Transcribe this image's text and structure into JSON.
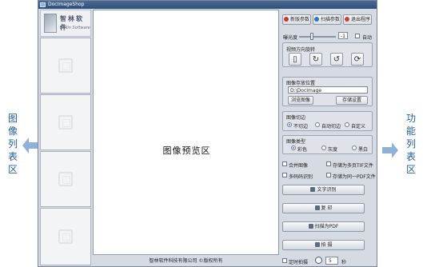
{
  "window": {
    "title": "DocImageShop"
  },
  "logo": {
    "brand_cn": "智林软件",
    "brand_en": "Zhilin Software"
  },
  "preview": {
    "label": "图像预览区"
  },
  "footer": {
    "copyright": "智林软件科技有限公司 ©版权所有"
  },
  "toolbar": {
    "new_params": "新版参数",
    "scan_params": "扫描参数",
    "exit": "退出程序"
  },
  "exposure": {
    "label": "曝光度",
    "value": "-1",
    "auto_label": "自动",
    "level": 0.35
  },
  "rotation": {
    "title": "视频方向旋转"
  },
  "storage": {
    "title": "图像存放位置",
    "path": "D:\\DocImage",
    "browse": "浏览图像",
    "save_settings": "存储设置"
  },
  "crop": {
    "title": "图像切边",
    "options": [
      "不切边",
      "自动切边",
      "自定义"
    ],
    "selected": 0
  },
  "color": {
    "title": "图像类型",
    "options": [
      "彩色",
      "灰度",
      "黑白"
    ],
    "selected": 0
  },
  "options": {
    "merge_image": "合并图像",
    "save_multi_tif": "存储为多页TIF文件",
    "multi_barcode": "多码码识别",
    "save_single_pdf": "存储为同一PDF文件"
  },
  "actions": {
    "ocr": "文字识别",
    "print": "复 印",
    "to_pdf": "扫描为PDF",
    "capture": "拍 摄"
  },
  "timer": {
    "label": "定时拍摄",
    "value": "5",
    "unit": "秒"
  },
  "annotations": {
    "left": [
      "图",
      "像",
      "列",
      "表",
      "区"
    ],
    "right": [
      "功",
      "能",
      "列",
      "表",
      "区"
    ]
  }
}
